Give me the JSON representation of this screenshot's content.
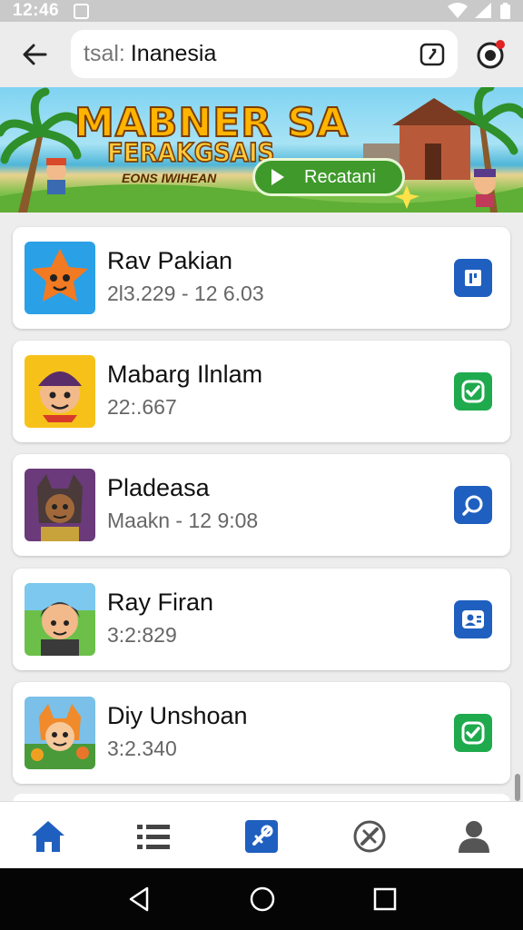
{
  "status_bar": {
    "time": "12:46"
  },
  "search": {
    "placeholder": "tsal:",
    "query": "Inanesia"
  },
  "banner": {
    "title": "MABNER SA",
    "subtitle": "FERAKGSAIS",
    "tagline": "EONS IWIHEAN",
    "button_label": "Recatani"
  },
  "items": [
    {
      "name": "Rav Pakian",
      "meta": "2l3.229  -  12 6.03",
      "thumb": "star-creature",
      "action_icon": "book-icon",
      "action_color": "#1f5fbf"
    },
    {
      "name": "Mabarg Ilnlam",
      "meta": "22:.667",
      "thumb": "pirate-boy",
      "action_icon": "check-icon",
      "action_color": "#1faa4d"
    },
    {
      "name": "Pladeasa",
      "meta": "Maakn  -  12 9:08",
      "thumb": "wolf-warrior",
      "action_icon": "search-icon",
      "action_color": "#1f5fbf"
    },
    {
      "name": "Ray Firan",
      "meta": "3:2:829",
      "thumb": "helmet-hero",
      "action_icon": "contact-card-icon",
      "action_color": "#1f5fbf"
    },
    {
      "name": "Diy Unshoan",
      "meta": "3:2.340",
      "thumb": "fox-adventurer",
      "action_icon": "check-icon",
      "action_color": "#1faa4d"
    }
  ],
  "bottom_nav": [
    "home-icon",
    "list-icon",
    "games-icon",
    "compass-icon",
    "profile-icon"
  ],
  "colors": {
    "accent": "#1f5fbf",
    "success": "#1faa4d"
  }
}
